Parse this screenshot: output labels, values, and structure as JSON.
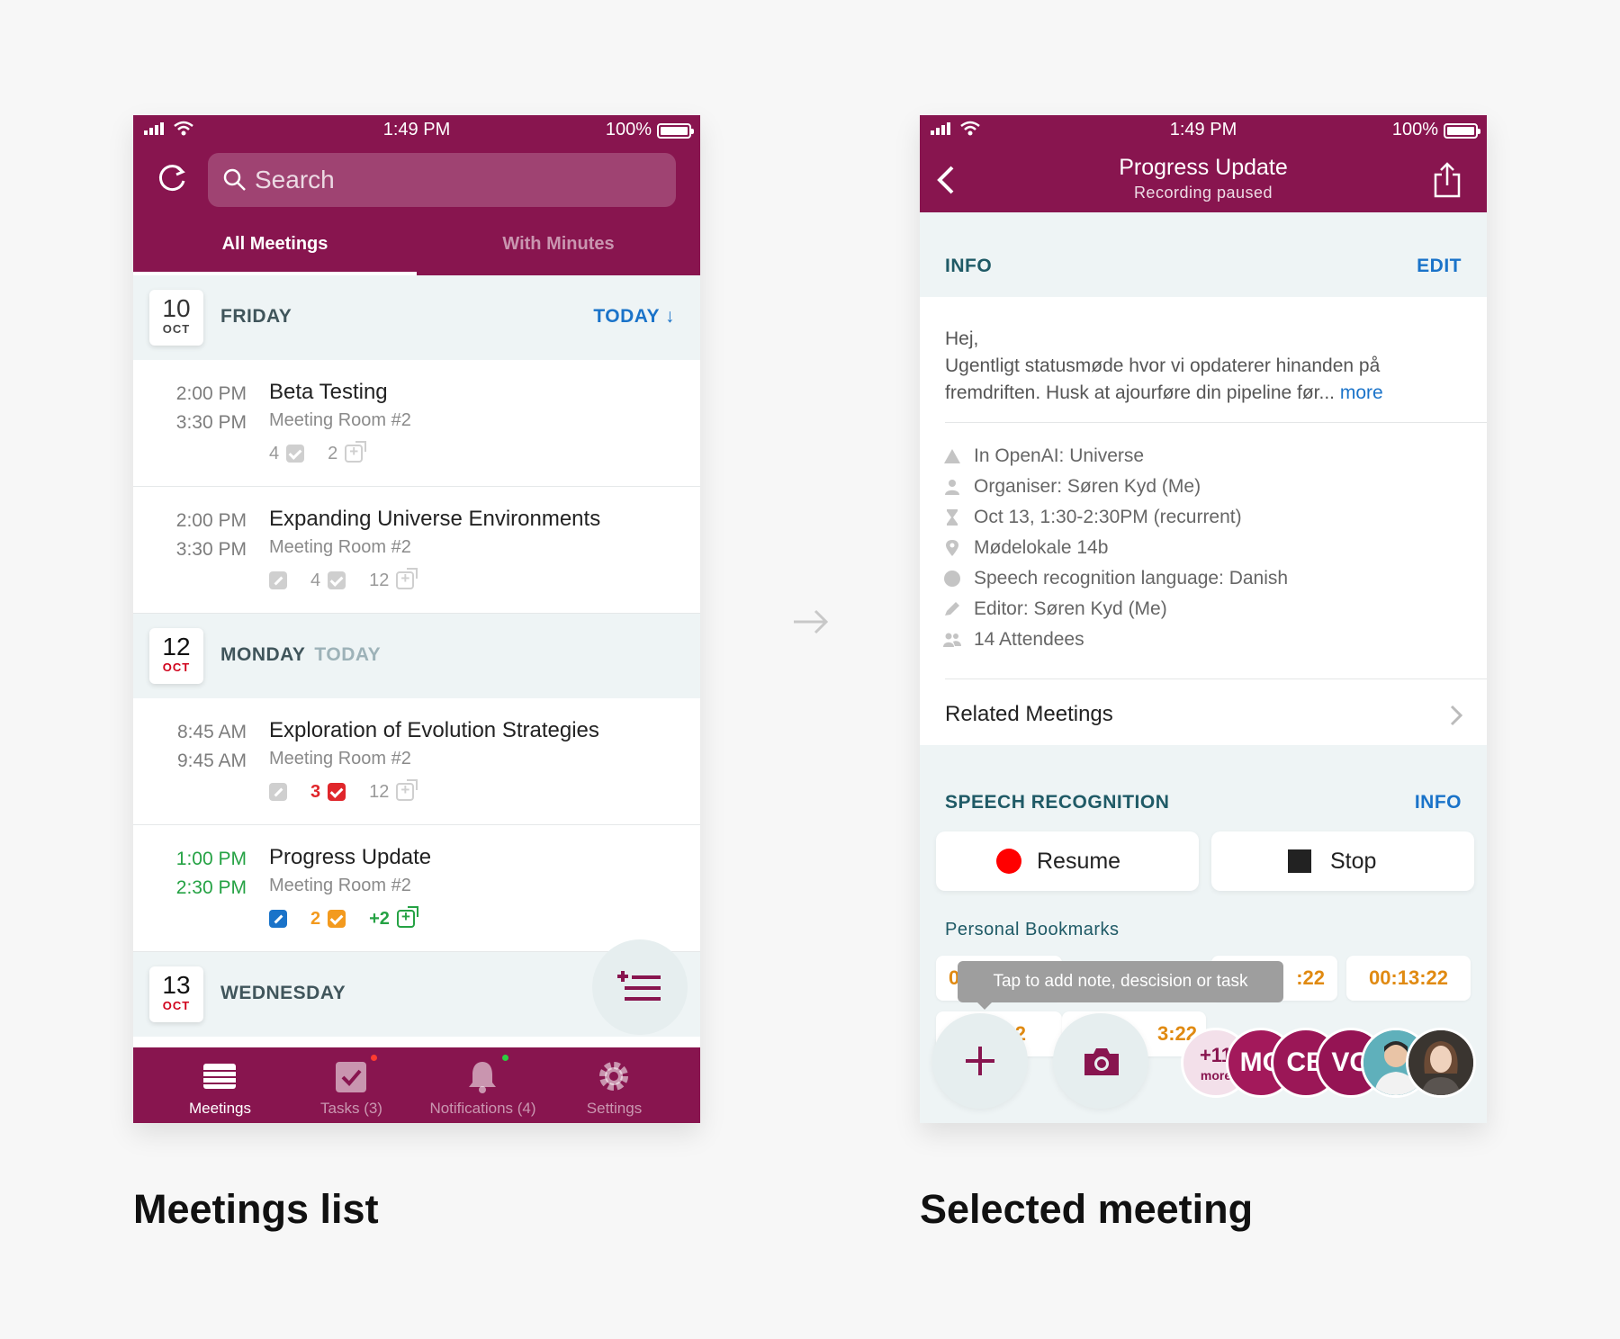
{
  "status_bar": {
    "time": "1:49 PM",
    "battery": "100%"
  },
  "meetings_list": {
    "search_placeholder": "Search",
    "tabs": [
      "All Meetings",
      "With Minutes"
    ],
    "days": [
      {
        "num": "10",
        "month": "OCT",
        "name": "FRIDAY",
        "link": "TODAY ↓"
      },
      {
        "num": "12",
        "month": "OCT",
        "name": "MONDAY",
        "today": "TODAY"
      },
      {
        "num": "13",
        "month": "OCT",
        "name": "WEDNESDAY"
      }
    ],
    "meetings": [
      {
        "start": "2:00 PM",
        "end": "3:30 PM",
        "title": "Beta Testing",
        "room": "Meeting Room #2",
        "tasks": "4",
        "copies": "2"
      },
      {
        "start": "2:00 PM",
        "end": "3:30 PM",
        "title": "Expanding Universe Environments",
        "room": "Meeting Room #2",
        "tasks": "4",
        "copies": "12"
      },
      {
        "start": "8:45 AM",
        "end": "9:45 AM",
        "title": "Exploration of Evolution Strategies",
        "room": "Meeting Room #2",
        "tasks": "3",
        "copies": "12"
      },
      {
        "start": "1:00 PM",
        "end": "2:30 PM",
        "title": "Progress Update",
        "room": "Meeting Room #2",
        "tasks": "2",
        "copies": "+2"
      }
    ],
    "tabbar": [
      "Meetings",
      "Tasks (3)",
      "Notifications (4)",
      "Settings"
    ]
  },
  "selected_meeting": {
    "title": "Progress Update",
    "subtitle": "Recording paused",
    "info_label": "INFO",
    "edit_label": "EDIT",
    "description_lines": [
      "Hej,",
      "Ugentligt statusmøde hvor vi opdaterer hinanden på",
      "fremdriften. Husk at ajourføre din pipeline før..."
    ],
    "more_label": "more",
    "properties": [
      {
        "icon": "workspace-icon",
        "text": "In OpenAI: Universe"
      },
      {
        "icon": "person-icon",
        "text": "Organiser: Søren Kyd (Me)"
      },
      {
        "icon": "hourglass-icon",
        "text": "Oct 13, 1:30-2:30PM (recurrent)"
      },
      {
        "icon": "location-pin-icon",
        "text": "Mødelokale 14b"
      },
      {
        "icon": "language-dot-icon",
        "text": "Speech recognition language: Danish"
      },
      {
        "icon": "pencil-icon",
        "text": "Editor: Søren Kyd (Me)"
      },
      {
        "icon": "attendees-icon",
        "text": "14 Attendees"
      }
    ],
    "related_label": "Related Meetings",
    "speech_label": "SPEECH RECOGNITION",
    "speech_info": "INFO",
    "resume_label": "Resume",
    "stop_label": "Stop",
    "bookmarks_label": "Personal Bookmarks",
    "bookmarks": [
      "0",
      ":22",
      "00:13:22",
      "22",
      "3:22"
    ],
    "tooltip": "Tap to add note, descision or task",
    "attendees_more": {
      "count": "+11",
      "label": "more"
    },
    "attendee_initials": [
      "MC",
      "CB",
      "VG"
    ],
    "colors": {
      "brand": "#88154f",
      "link": "#1a73c9",
      "bookmark": "#e08a12"
    }
  },
  "captions": {
    "left": "Meetings list",
    "right": "Selected meeting"
  }
}
